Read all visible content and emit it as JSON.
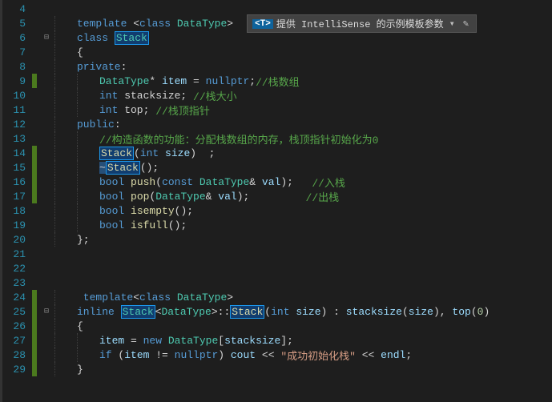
{
  "tooltip": {
    "badge": "<T>",
    "text": "提供 IntelliSense 的示例模板参数",
    "dropdown": "▾",
    "edit": "✎"
  },
  "fold": {
    "minus": "⊟"
  },
  "lines": {
    "l4": {
      "num": "4"
    },
    "l5": {
      "num": "5",
      "t1": "template",
      "t2": "<",
      "t3": "class",
      "t4": " DataType",
      "t5": ">"
    },
    "l6": {
      "num": "6",
      "t1": "class",
      "t2": "Stack"
    },
    "l7": {
      "num": "7",
      "t1": "{"
    },
    "l8": {
      "num": "8",
      "t1": "private",
      "t2": ":"
    },
    "l9": {
      "num": "9",
      "t1": "DataType",
      "t2": "* ",
      "t3": "item",
      "t4": " = ",
      "t5": "nullptr",
      "t6": ";",
      "c": "//栈数组"
    },
    "l10": {
      "num": "10",
      "t1": "int",
      "t2": " stacksize",
      "t3": "; ",
      "c": "//栈大小"
    },
    "l11": {
      "num": "11",
      "t1": "int",
      "t2": " top",
      "t3": "; ",
      "c": "//栈顶指针"
    },
    "l12": {
      "num": "12",
      "t1": "public",
      "t2": ":"
    },
    "l13": {
      "num": "13",
      "c": "//构造函数的功能：分配栈数组的内存，栈顶指针初始化为0"
    },
    "l14": {
      "num": "14",
      "t1": "Stack",
      "t2": "(",
      "t3": "int",
      "t4": " size",
      "t5": ")  ;"
    },
    "l15": {
      "num": "15",
      "t1": "~",
      "t2": "Stack",
      "t3": "();"
    },
    "l16": {
      "num": "16",
      "t1": "bool",
      "t2": "push",
      "t3": "(",
      "t4": "const",
      "t5": " DataType",
      "t6": "& ",
      "t7": "val",
      "t8": ");   ",
      "c": "//入栈"
    },
    "l17": {
      "num": "17",
      "t1": "bool",
      "t2": "pop",
      "t3": "(",
      "t4": "DataType",
      "t5": "& ",
      "t6": "val",
      "t7": ");         ",
      "c": "//出栈"
    },
    "l18": {
      "num": "18",
      "t1": "bool",
      "t2": "isempty",
      "t3": "();"
    },
    "l19": {
      "num": "19",
      "t1": "bool",
      "t2": "isfull",
      "t3": "();"
    },
    "l20": {
      "num": "20",
      "t1": "};"
    },
    "l21": {
      "num": "21"
    },
    "l22": {
      "num": "22"
    },
    "l23": {
      "num": "23"
    },
    "l24": {
      "num": "24",
      "t1": " template",
      "t2": "<",
      "t3": "class",
      "t4": " DataType",
      "t5": ">"
    },
    "l25": {
      "num": "25",
      "t1": "inline",
      "t2": "Stack",
      "t3": "<",
      "t4": "DataType",
      "t5": ">::",
      "t6": "Stack",
      "t7": "(",
      "t8": "int",
      "t9": " size",
      "t10": ") : ",
      "t11": "stacksize",
      "t12": "(",
      "t13": "size",
      "t14": "), ",
      "t15": "top",
      "t16": "(",
      "t17": "0",
      "t18": ")"
    },
    "l26": {
      "num": "26",
      "t1": "{"
    },
    "l27": {
      "num": "27",
      "t1": "item",
      "t2": " = ",
      "t3": "new",
      "t4": " DataType",
      "t5": "[",
      "t6": "stacksize",
      "t7": "];"
    },
    "l28": {
      "num": "28",
      "t1": "if",
      "t2": " (",
      "t3": "item",
      "t4": " != ",
      "t5": "nullptr",
      "t6": ") ",
      "t7": "cout",
      "t8": " << ",
      "s": "\"成功初始化栈\"",
      "t9": " << ",
      "t10": "endl",
      "t11": ";"
    },
    "l29": {
      "num": "29",
      "t1": "}"
    }
  }
}
